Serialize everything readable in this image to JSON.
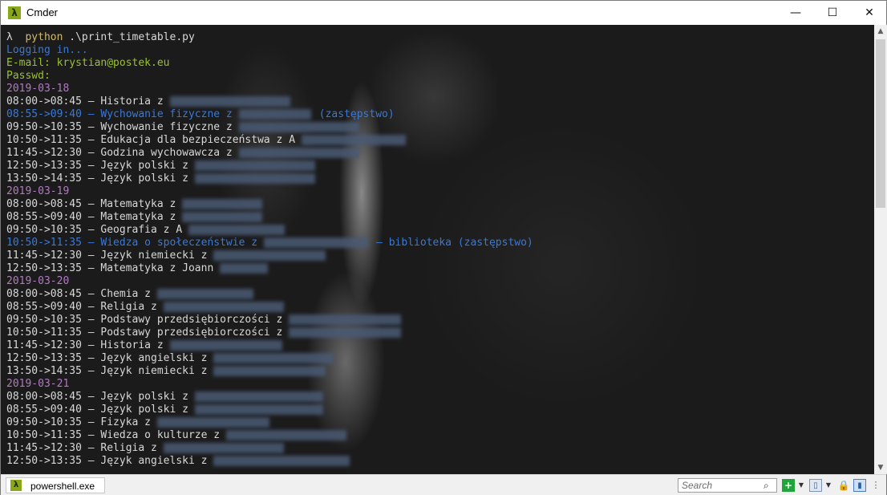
{
  "window": {
    "title": "Cmder",
    "app_icon": "λ",
    "minimize": "—",
    "maximize": "☐",
    "close": "✕"
  },
  "terminal": {
    "lines": [
      {
        "parts": [
          {
            "t": "λ ",
            "c": "c-lambda"
          },
          {
            "t": " python ",
            "c": "c-prompt"
          },
          {
            "t": ".\\print_timetable.py",
            "c": "c-white"
          }
        ]
      },
      {
        "parts": [
          {
            "t": "Logging in...",
            "c": "c-blue"
          }
        ]
      },
      {
        "parts": [
          {
            "t": "E-mail: krystian@postek.eu",
            "c": "c-green"
          }
        ]
      },
      {
        "parts": [
          {
            "t": "Passwd:",
            "c": "c-green"
          }
        ]
      },
      {
        "parts": [
          {
            "t": "2019-03-18",
            "c": "c-magenta"
          }
        ]
      },
      {
        "parts": [
          {
            "t": "08:00->08:45 – Historia z",
            "c": "c-white"
          }
        ],
        "blur": 150
      },
      {
        "parts": [
          {
            "t": "08:55->09:40 – Wychowanie fizyczne z",
            "c": "c-blue"
          }
        ],
        "blur": 90,
        "after": {
          "t": "(zastępstwo)",
          "c": "c-blue"
        }
      },
      {
        "parts": [
          {
            "t": "09:50->10:35 – Wychowanie fizyczne z",
            "c": "c-white"
          }
        ],
        "blur": 150
      },
      {
        "parts": [
          {
            "t": "10:50->11:35 – Edukacja dla bezpieczeństwa z A",
            "c": "c-white"
          }
        ],
        "blur": 130
      },
      {
        "parts": [
          {
            "t": "11:45->12:30 – Godzina wychowawcza z",
            "c": "c-white"
          }
        ],
        "blur": 150
      },
      {
        "parts": [
          {
            "t": "12:50->13:35 – Język polski z",
            "c": "c-white"
          }
        ],
        "blur": 150
      },
      {
        "parts": [
          {
            "t": "13:50->14:35 – Język polski z",
            "c": "c-white"
          }
        ],
        "blur": 150
      },
      {
        "parts": [
          {
            "t": "2019-03-19",
            "c": "c-magenta"
          }
        ]
      },
      {
        "parts": [
          {
            "t": "08:00->08:45 – Matematyka z",
            "c": "c-white"
          }
        ],
        "blur": 100
      },
      {
        "parts": [
          {
            "t": "08:55->09:40 – Matematyka z",
            "c": "c-white"
          }
        ],
        "blur": 100
      },
      {
        "parts": [
          {
            "t": "09:50->10:35 – Geografia z A",
            "c": "c-white"
          }
        ],
        "blur": 120
      },
      {
        "parts": [
          {
            "t": "10:50->11:35 – Wiedza o społeczeństwie z",
            "c": "c-blue"
          }
        ],
        "blur": 130,
        "after": {
          "t": "– biblioteka (zastępstwo)",
          "c": "c-blue"
        }
      },
      {
        "parts": [
          {
            "t": "11:45->12:30 – Język niemiecki z",
            "c": "c-white"
          }
        ],
        "blur": 140
      },
      {
        "parts": [
          {
            "t": "12:50->13:35 – Matematyka z Joann",
            "c": "c-white"
          }
        ],
        "blur": 60
      },
      {
        "parts": [
          {
            "t": "2019-03-20",
            "c": "c-magenta"
          }
        ]
      },
      {
        "parts": [
          {
            "t": "08:00->08:45 – Chemia z",
            "c": "c-white"
          }
        ],
        "blur": 120
      },
      {
        "parts": [
          {
            "t": "08:55->09:40 – Religia z",
            "c": "c-white"
          }
        ],
        "blur": 150
      },
      {
        "parts": [
          {
            "t": "09:50->10:35 – Podstawy przedsiębiorczości z",
            "c": "c-white"
          }
        ],
        "blur": 140
      },
      {
        "parts": [
          {
            "t": "10:50->11:35 – Podstawy przedsiębiorczości z",
            "c": "c-white"
          }
        ],
        "blur": 140
      },
      {
        "parts": [
          {
            "t": "11:45->12:30 – Historia z",
            "c": "c-white"
          }
        ],
        "blur": 140
      },
      {
        "parts": [
          {
            "t": "12:50->13:35 – Język angielski z",
            "c": "c-white"
          }
        ],
        "blur": 150
      },
      {
        "parts": [
          {
            "t": "13:50->14:35 – Język niemiecki z",
            "c": "c-white"
          }
        ],
        "blur": 140
      },
      {
        "parts": [
          {
            "t": "2019-03-21",
            "c": "c-magenta"
          }
        ]
      },
      {
        "parts": [
          {
            "t": "08:00->08:45 – Język polski z",
            "c": "c-white"
          }
        ],
        "blur": 160
      },
      {
        "parts": [
          {
            "t": "08:55->09:40 – Język polski z",
            "c": "c-white"
          }
        ],
        "blur": 160
      },
      {
        "parts": [
          {
            "t": "09:50->10:35 – Fizyka z",
            "c": "c-white"
          }
        ],
        "blur": 140
      },
      {
        "parts": [
          {
            "t": "10:50->11:35 – Wiedza o kulturze z",
            "c": "c-white"
          }
        ],
        "blur": 150
      },
      {
        "parts": [
          {
            "t": "11:45->12:30 – Religia z",
            "c": "c-white"
          }
        ],
        "blur": 150
      },
      {
        "parts": [
          {
            "t": "12:50->13:35 – Język angielski z",
            "c": "c-white"
          }
        ],
        "blur": 170
      }
    ]
  },
  "scrollbar": {
    "up": "▲",
    "down": "▼"
  },
  "statusbar": {
    "tab_icon": "λ",
    "tab_label": "powershell.exe",
    "search_placeholder": "Search",
    "search_icon": "⌕",
    "new_console_icon": "+",
    "dropdown_icon": "▼",
    "split_icon": "▯",
    "lock_icon": "🔒",
    "buffer_icon": "▮",
    "panel_icon": "⋮"
  }
}
